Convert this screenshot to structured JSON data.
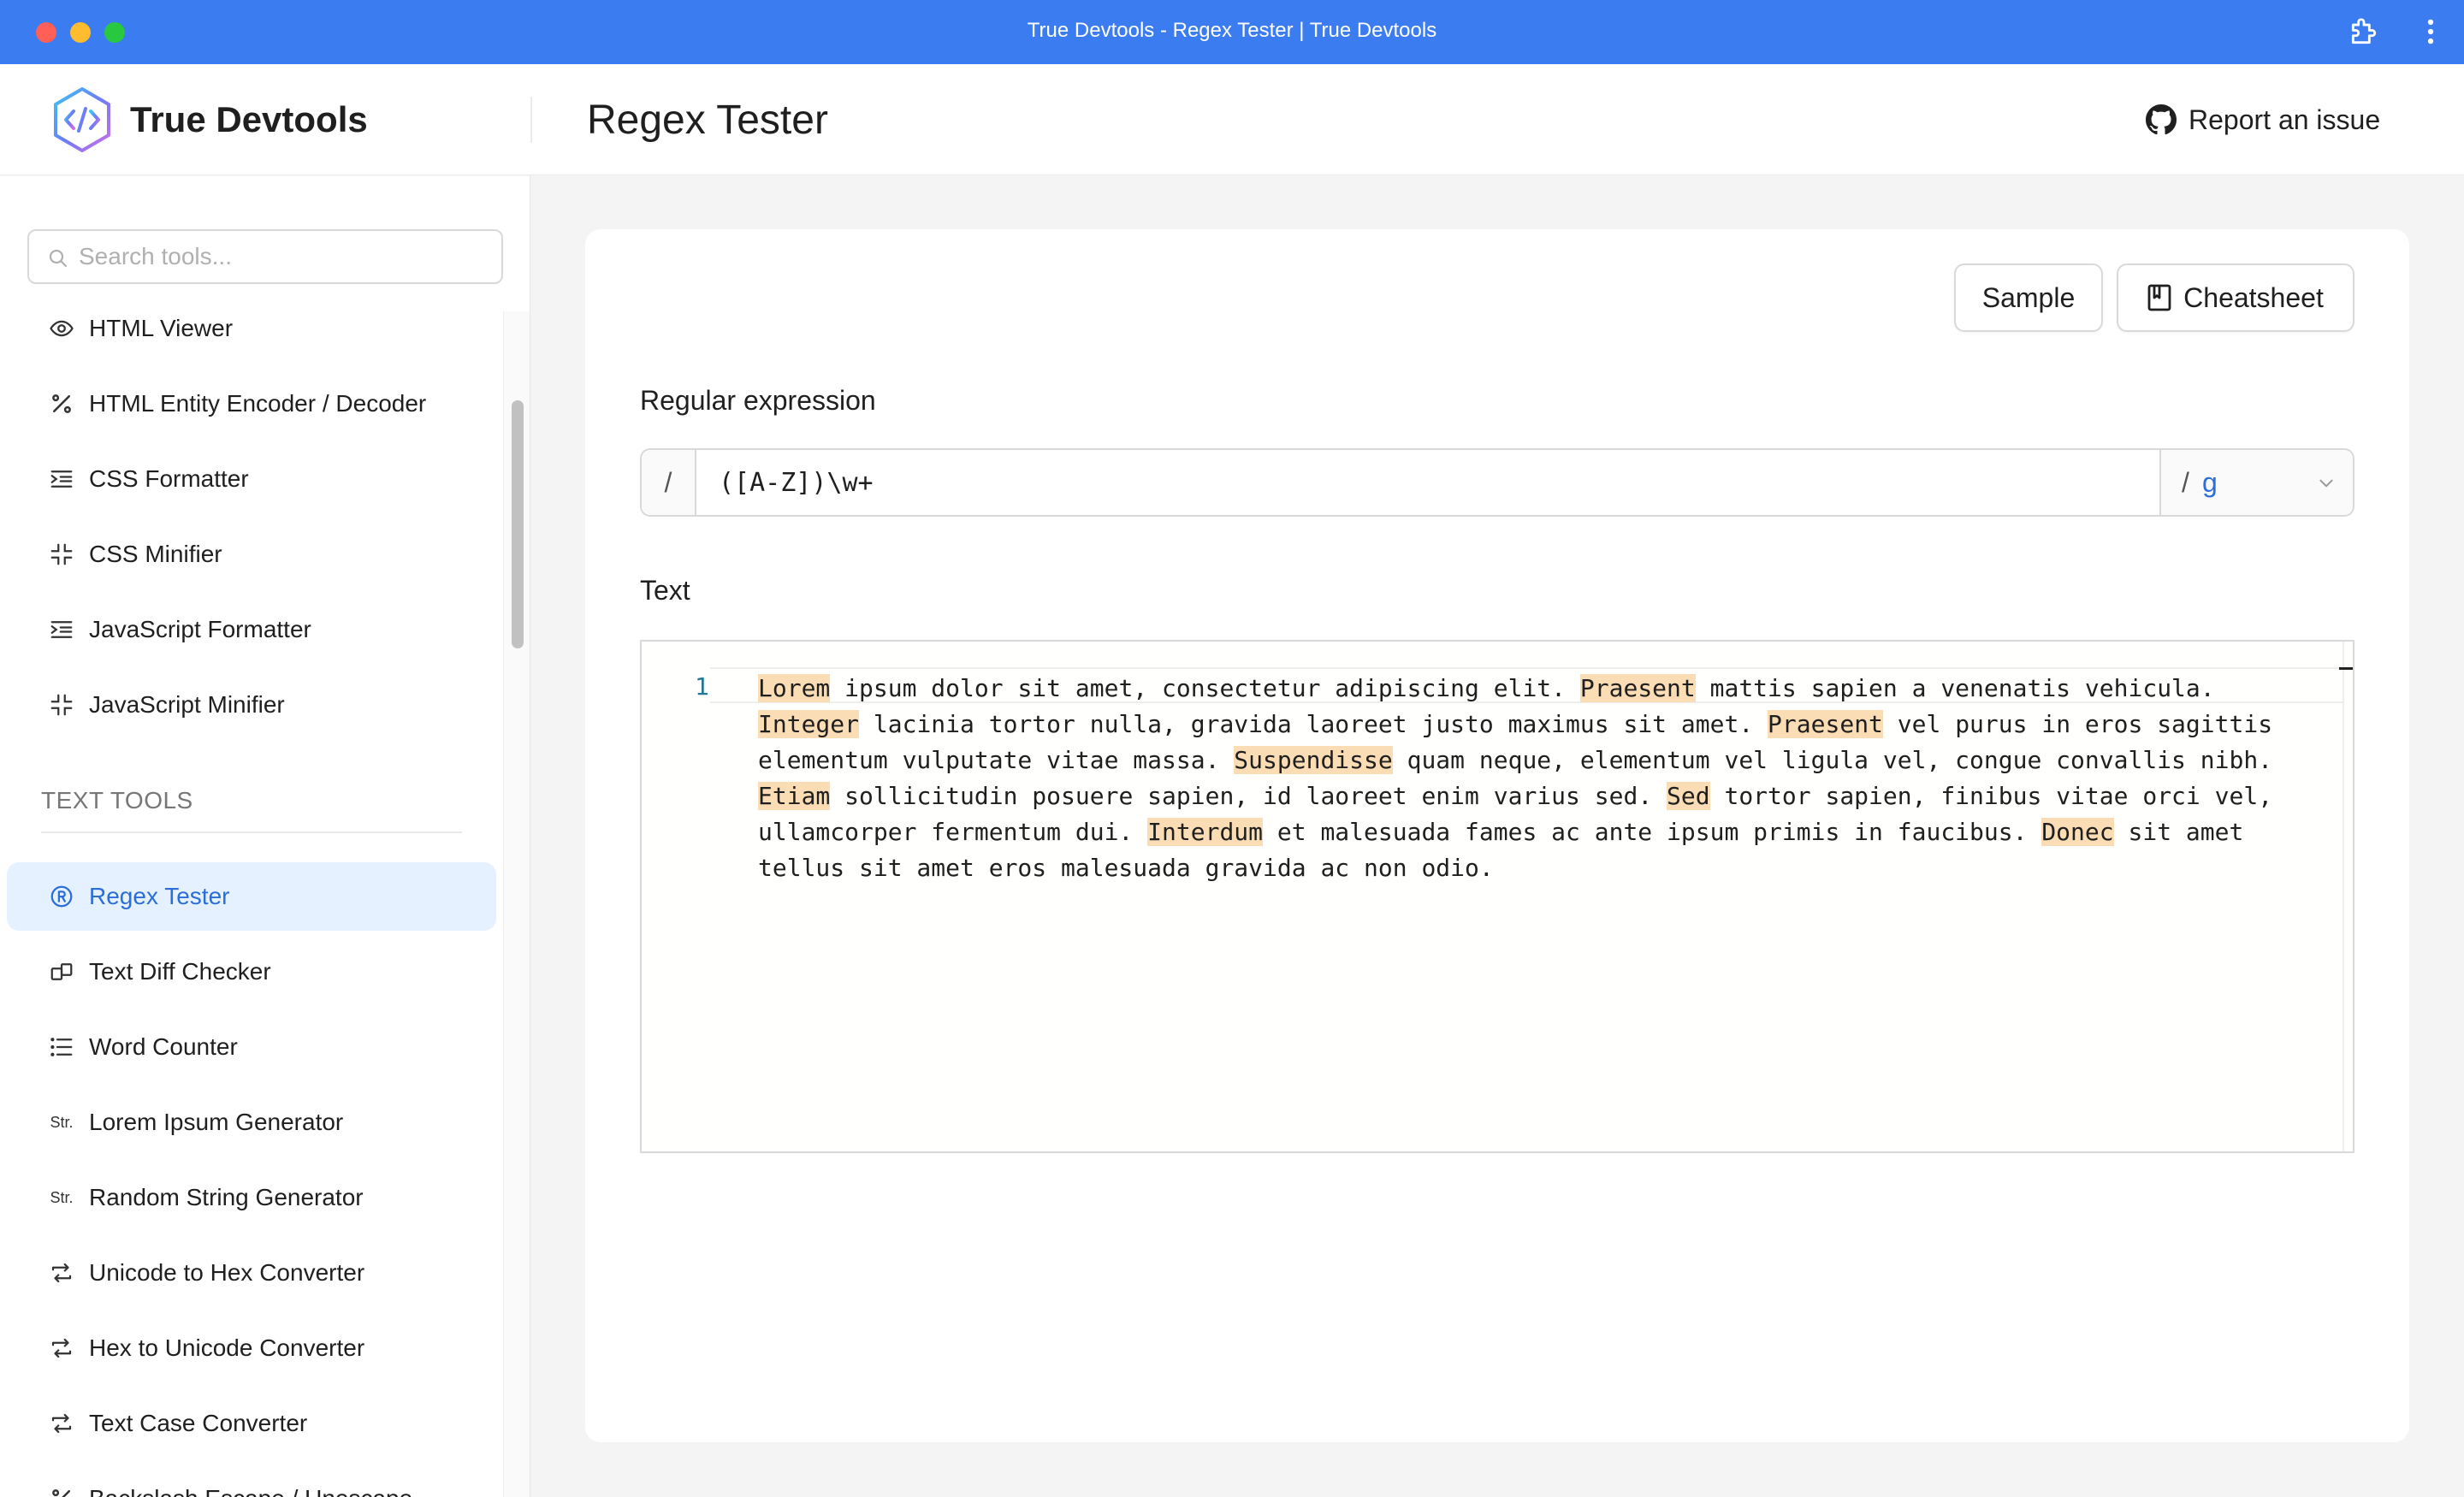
{
  "window": {
    "title": "True Devtools - Regex Tester | True Devtools"
  },
  "header": {
    "brand": "True Devtools",
    "page_title": "Regex Tester",
    "report_label": "Report an issue"
  },
  "sidebar": {
    "search_placeholder": "Search tools...",
    "section_title": "TEXT TOOLS",
    "items_top": [
      {
        "label": "HTML Viewer",
        "icon": "eye-icon"
      },
      {
        "label": "HTML Entity Encoder / Decoder",
        "icon": "percent-icon"
      },
      {
        "label": "CSS Formatter",
        "icon": "indent-icon"
      },
      {
        "label": "CSS Minifier",
        "icon": "minimize-icon"
      },
      {
        "label": "JavaScript Formatter",
        "icon": "indent-icon"
      },
      {
        "label": "JavaScript Minifier",
        "icon": "minimize-icon"
      }
    ],
    "items_text": [
      {
        "label": "Regex Tester",
        "icon": "registered-icon",
        "active": true
      },
      {
        "label": "Text Diff Checker",
        "icon": "diff-icon"
      },
      {
        "label": "Word Counter",
        "icon": "list-icon"
      },
      {
        "label": "Lorem Ipsum Generator",
        "icon": "str-icon",
        "icon_text": "Str."
      },
      {
        "label": "Random String Generator",
        "icon": "str-icon",
        "icon_text": "Str."
      },
      {
        "label": "Unicode to Hex Converter",
        "icon": "swap-icon"
      },
      {
        "label": "Hex to Unicode Converter",
        "icon": "swap-icon"
      },
      {
        "label": "Text Case Converter",
        "icon": "swap-icon"
      },
      {
        "label": "Backslash Escape / Unescape",
        "icon": "percent-icon"
      }
    ]
  },
  "main": {
    "sample_button": "Sample",
    "cheatsheet_button": "Cheatsheet",
    "regex_label": "Regular expression",
    "regex_prefix": "/",
    "regex_value": "([A-Z])\\w+",
    "flags_prefix": "/",
    "flags_value": "g",
    "text_label": "Text",
    "editor": {
      "line_number": "1",
      "lines": [
        [
          {
            "t": "Lorem",
            "h": true
          },
          {
            "t": " ipsum dolor sit amet, consectetur adipiscing elit. "
          },
          {
            "t": "Praesent",
            "h": true
          },
          {
            "t": " mattis sapien a venenatis vehicula."
          }
        ],
        [
          {
            "t": "Integer",
            "h": true
          },
          {
            "t": " lacinia tortor nulla, gravida laoreet justo maximus sit amet. "
          },
          {
            "t": "Praesent",
            "h": true
          },
          {
            "t": " vel purus in eros sagittis"
          }
        ],
        [
          {
            "t": "elementum vulputate vitae massa. "
          },
          {
            "t": "Suspendisse",
            "h": true
          },
          {
            "t": " quam neque, elementum vel ligula vel, congue convallis nibh."
          }
        ],
        [
          {
            "t": "Etiam",
            "h": true
          },
          {
            "t": " sollicitudin posuere sapien, id laoreet enim varius sed. "
          },
          {
            "t": "Sed",
            "h": true
          },
          {
            "t": " tortor sapien, finibus vitae orci vel,"
          }
        ],
        [
          {
            "t": "ullamcorper fermentum dui. "
          },
          {
            "t": "Interdum",
            "h": true
          },
          {
            "t": " et malesuada fames ac ante ipsum primis in faucibus. "
          },
          {
            "t": "Donec",
            "h": true
          },
          {
            "t": " sit amet"
          }
        ],
        [
          {
            "t": "tellus sit amet eros malesuada gravida ac non odio."
          }
        ]
      ]
    }
  },
  "colors": {
    "titlebar": "#3b7cf0",
    "accent": "#2a6ed8",
    "active_bg": "#e6f1ff",
    "match_highlight": "#fadcb5"
  }
}
